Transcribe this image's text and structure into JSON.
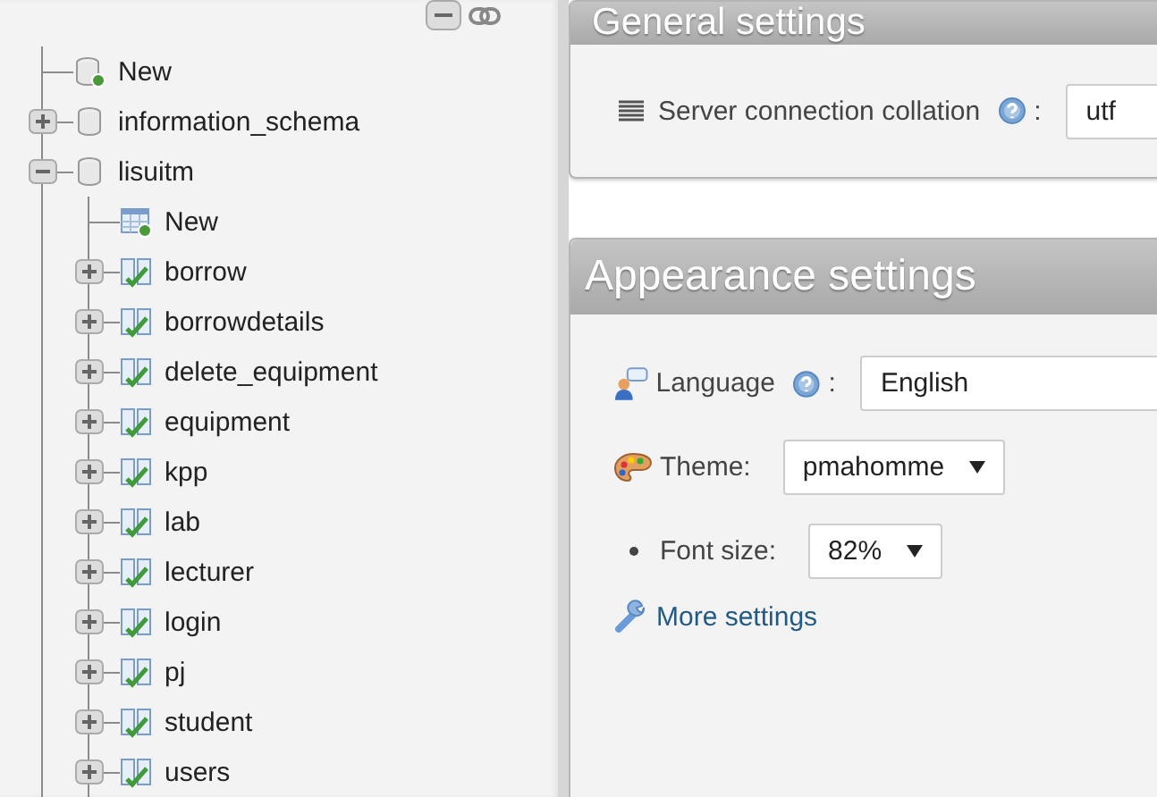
{
  "tree": [
    {
      "kind": "new",
      "label": "New"
    },
    {
      "kind": "database",
      "label": "information_schema",
      "expanded": false
    },
    {
      "kind": "database",
      "label": "lisuitm",
      "expanded": true,
      "children": [
        {
          "kind": "new_table",
          "label": "New"
        },
        {
          "kind": "table",
          "label": "borrow",
          "expanded": false
        },
        {
          "kind": "table",
          "label": "borrowdetails",
          "expanded": false
        },
        {
          "kind": "table",
          "label": "delete_equipment",
          "expanded": false
        },
        {
          "kind": "table",
          "label": "equipment",
          "expanded": false
        },
        {
          "kind": "table",
          "label": "kpp",
          "expanded": false
        },
        {
          "kind": "table",
          "label": "lab",
          "expanded": false
        },
        {
          "kind": "table",
          "label": "lecturer",
          "expanded": false
        },
        {
          "kind": "table",
          "label": "login",
          "expanded": false
        },
        {
          "kind": "table",
          "label": "pj",
          "expanded": false
        },
        {
          "kind": "table",
          "label": "student",
          "expanded": false
        },
        {
          "kind": "table",
          "label": "users",
          "expanded": false
        }
      ]
    }
  ],
  "general_settings": {
    "title": "General settings",
    "fields": [
      {
        "kind": "collation",
        "label": "Server connection collation",
        "help": true,
        "separator": ":",
        "value": "utf"
      }
    ]
  },
  "appearance_settings": {
    "title": "Appearance settings",
    "fields": [
      {
        "kind": "language",
        "label": "Language",
        "help": true,
        "separator": ":",
        "value": "English"
      },
      {
        "kind": "theme",
        "label": "Theme:",
        "value": "pmahomme"
      },
      {
        "kind": "font_size",
        "label": "Font size:",
        "value": "82%"
      }
    ],
    "more_link": "More settings"
  }
}
